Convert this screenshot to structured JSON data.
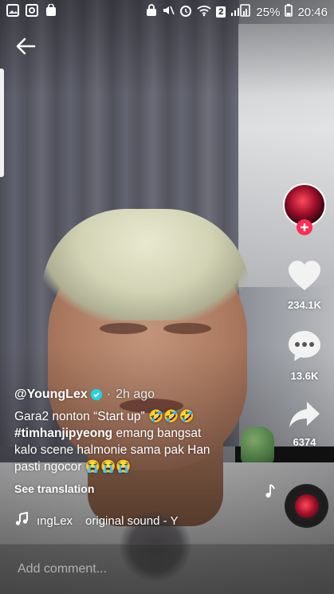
{
  "status_bar": {
    "battery_percent": "25%",
    "time": "20:46",
    "sim_badge": "2"
  },
  "video": {
    "author": "@YoungLex",
    "separator": "·",
    "posted": "2h ago",
    "caption_line1": "Gara2 nonton “Start up” 🤣🤣🤣",
    "hashtag": "#timhanjipyeong",
    "caption_line2_rest": " emang bangsat",
    "caption_line3": "kalo scene halmonie sama pak Han",
    "caption_line4": "pasti ngocor 😭😭😭",
    "see_translation": "See translation"
  },
  "actions": {
    "likes": "234.1K",
    "comments": "13.6K",
    "shares": "6374"
  },
  "music": {
    "text_left": "ıngLex",
    "text_right": "original sound - Y"
  },
  "comment_bar": {
    "placeholder": "Add comment..."
  },
  "icons": [
    "back-arrow-icon",
    "heart-icon",
    "comment-bubble-icon",
    "share-arrow-icon",
    "music-note-icon",
    "plus-icon",
    "verified-icon"
  ],
  "colors": {
    "follow_plus": "#fe2c55",
    "verified": "#20d5ec"
  }
}
